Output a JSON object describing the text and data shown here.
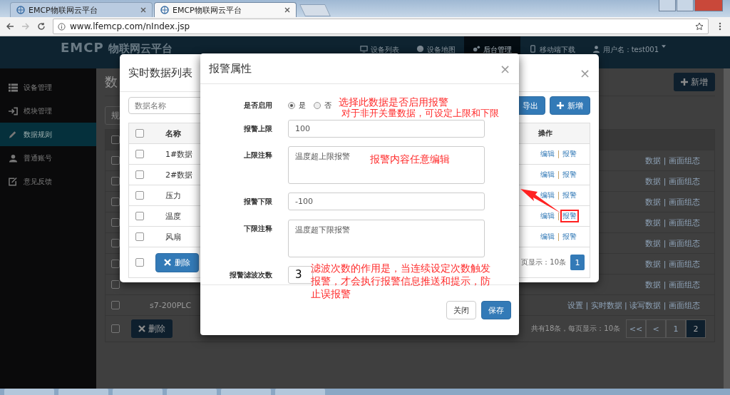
{
  "browser": {
    "tabs": [
      {
        "title": "EMCP物联网云平台",
        "selected": false
      },
      {
        "title": "EMCP物联网云平台",
        "selected": true
      }
    ],
    "url": "www.lfemcp.com/nIndex.jsp"
  },
  "navbar": {
    "logo_mark": "EMCP",
    "logo_text": "物联网云平台",
    "items": [
      {
        "label": "设备列表",
        "selected": false
      },
      {
        "label": "设备地图",
        "selected": false
      },
      {
        "label": "后台管理",
        "selected": true
      },
      {
        "label": "移动端下载",
        "selected": false
      }
    ],
    "user": "用户名：test001"
  },
  "sidebar": {
    "items": [
      {
        "label": "设备管理",
        "selected": false
      },
      {
        "label": "模块管理",
        "selected": false
      },
      {
        "label": "数据规则",
        "selected": true
      },
      {
        "label": "普通账号",
        "selected": false
      },
      {
        "label": "意见反馈",
        "selected": false
      }
    ]
  },
  "page": {
    "title": "数",
    "add_button": "新增",
    "filter": "规",
    "header_checked": false,
    "rows": [
      {
        "checked": false,
        "actions": "数据 | 画面组态"
      },
      {
        "checked": false,
        "actions": "数据 | 画面组态"
      },
      {
        "checked": false,
        "actions": "数据 | 画面组态"
      },
      {
        "checked": false,
        "actions": "数据 | 画面组态"
      },
      {
        "checked": false,
        "actions": "数据 | 画面组态"
      },
      {
        "checked": false,
        "actions": "数据 | 画面组态"
      },
      {
        "checked": false,
        "actions": "数据 | 画面组态"
      },
      {
        "checked": false,
        "name": "s7-200PLC",
        "actions": "设置 | 实时数据 | 读写数据 | 画面组态"
      }
    ],
    "footer_checked": false,
    "delete_button": "删除",
    "summary": "共有18条，每页显示：10条",
    "pagination": [
      {
        "label": "<<",
        "selected": false
      },
      {
        "label": "<",
        "selected": false
      },
      {
        "label": "1",
        "selected": false
      },
      {
        "label": "2",
        "selected": true
      }
    ]
  },
  "data_list_dialog": {
    "title": "实时数据列表",
    "close": "×",
    "search": {
      "placeholder": "数据名称"
    },
    "export_button": "导出",
    "add_button": "新增",
    "header_checked": false,
    "columns": [
      "名称",
      "操作"
    ],
    "rows": [
      {
        "checked": false,
        "name": "1#数据",
        "edit": "编辑",
        "alarm": "报警",
        "annotated": false
      },
      {
        "checked": false,
        "name": "2#数据",
        "edit": "编辑",
        "alarm": "报警",
        "annotated": false
      },
      {
        "checked": false,
        "name": "压力",
        "edit": "编辑",
        "alarm": "报警",
        "annotated": false
      },
      {
        "checked": false,
        "name": "温度",
        "edit": "编辑",
        "alarm": "报警",
        "annotated": true
      },
      {
        "checked": false,
        "name": "风扇",
        "edit": "编辑",
        "alarm": "报警",
        "annotated": false
      }
    ],
    "footer_checked": false,
    "delete_button": "删除",
    "summary": "页显示：10条",
    "page": "1"
  },
  "alarm_dialog": {
    "title": "报警属性",
    "close": "×",
    "enable": {
      "label": "是否启用",
      "options": [
        {
          "label": "是",
          "selected": true
        },
        {
          "label": "否",
          "selected": false
        }
      ]
    },
    "fields": [
      {
        "kind": "input",
        "label": "报警上限",
        "value": "100"
      },
      {
        "kind": "textarea",
        "label": "上限注释",
        "value": "温度超上限报警"
      },
      {
        "kind": "input",
        "label": "报警下限",
        "value": "-100"
      },
      {
        "kind": "textarea",
        "label": "下限注释",
        "value": "温度超下限报警"
      },
      {
        "kind": "input",
        "label": "报警滤波次数",
        "value": "3"
      }
    ],
    "close_button": "关闭",
    "save_button": "保存"
  },
  "annotations": [
    "选择此数据是否启用报警",
    "对于非开关量数据，可设定上限和下限",
    "报警内容任意编辑",
    "滤波次数的作用是，当连续设定次数触发报警，才会执行报警信息推送和提示，防止误报警"
  ]
}
